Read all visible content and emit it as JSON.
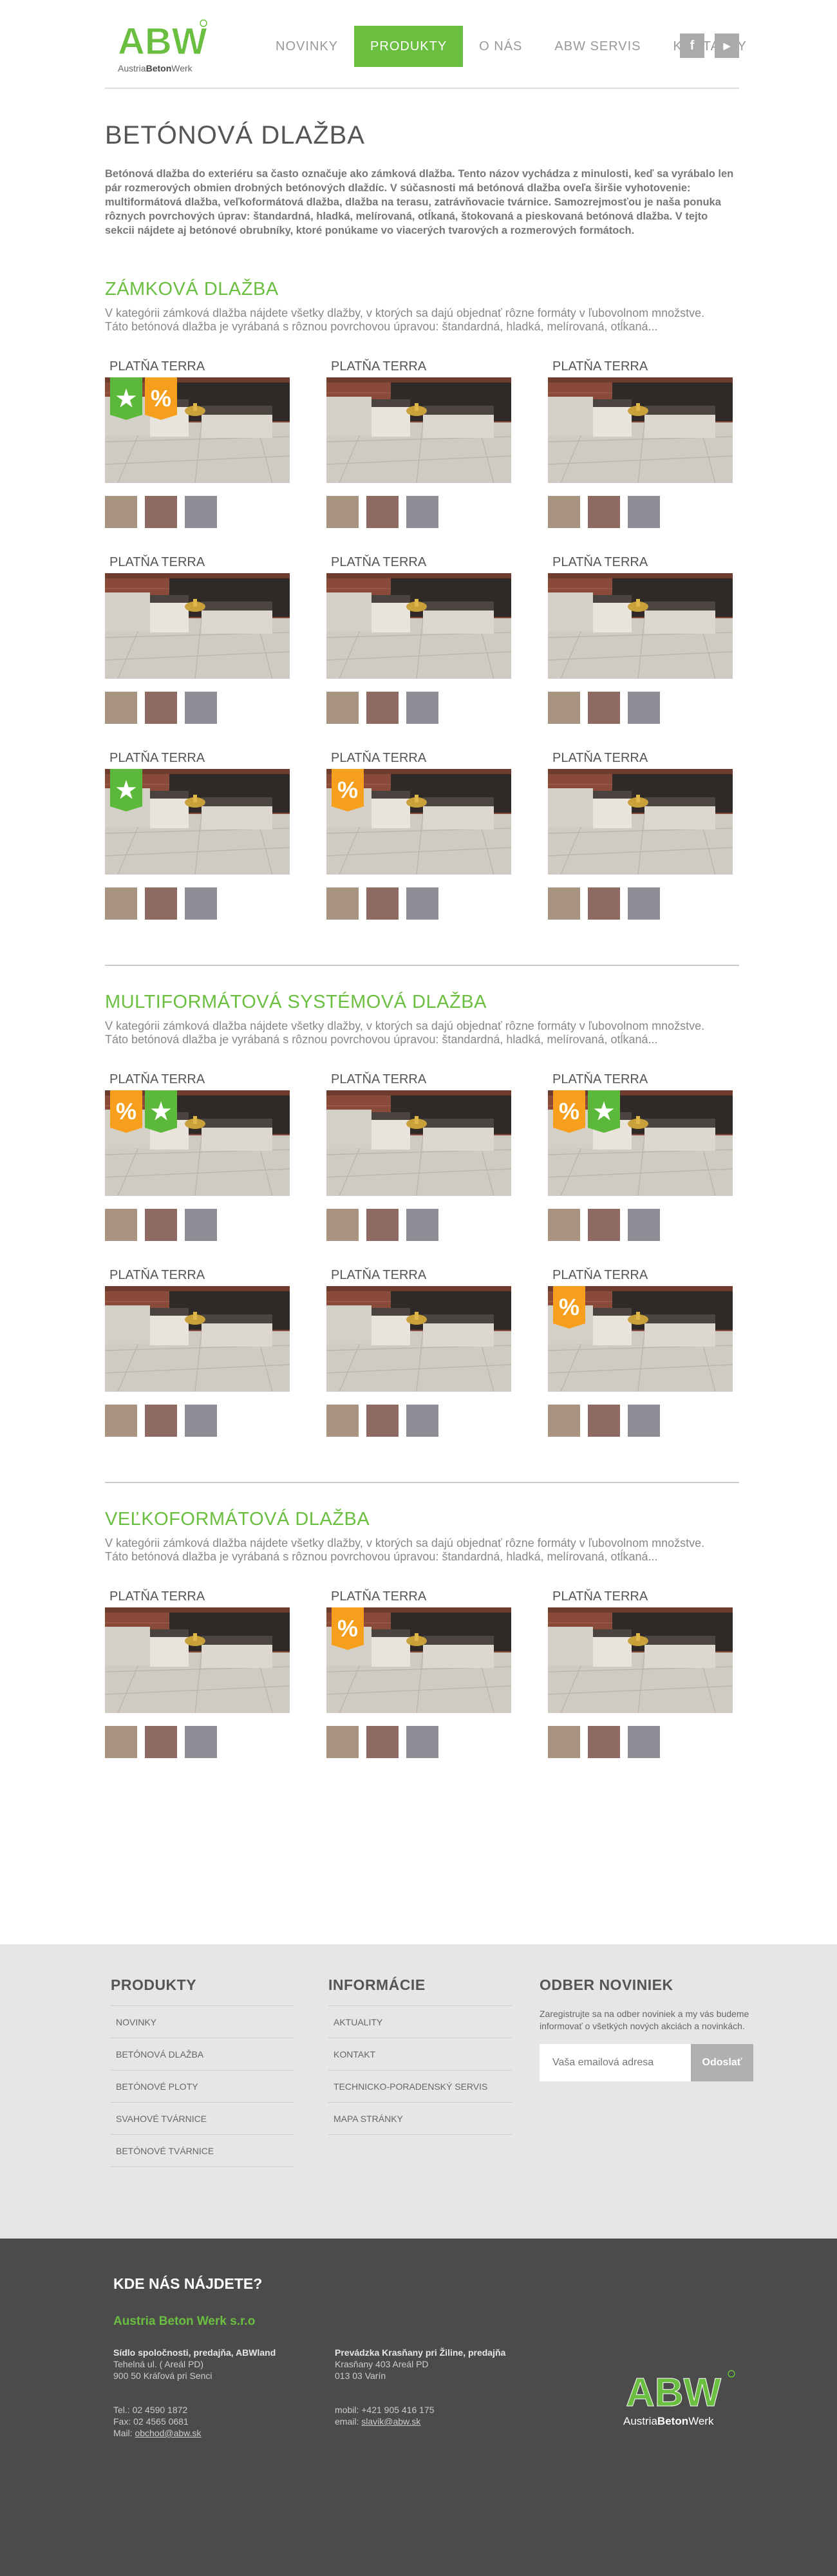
{
  "header": {
    "logo_text_light_1": "Austria",
    "logo_text_bold": "Beton",
    "logo_text_light_2": "Werk",
    "nav": [
      "NOVINKY",
      "PRODUKTY",
      "O NÁS",
      "ABW SERVIS",
      "KONTAKTY"
    ],
    "active_nav": "PRODUKTY",
    "social": [
      {
        "icon": "facebook-icon",
        "glyph": "f"
      },
      {
        "icon": "youtube-icon",
        "glyph": "▶"
      }
    ]
  },
  "page": {
    "title": "BETÓNOVÁ DLAŽBA",
    "intro": "Betónová dlažba do exteriéru sa často označuje ako zámková dlažba. Tento názov vychádza z minulosti, keď sa vyrábalo len pár rozmerových obmien drobných betónových dlaždíc. V súčasnosti má betónová dlažba oveľa širšie vyhotovenie: multiformátová dlažba, veľkoformátová dlažba, dlažba na terasu, zatrávňovacie tvárnice. Samozrejmosťou je naša ponuka rôznych povrchových úprav: štandardná, hladká, melírovaná, otĺkaná, štokovaná a pieskovaná betónová dlažba. V tejto sekcii nájdete aj betónové obrubníky, ktoré ponúkame vo viacerých tvarových a rozmerových formátoch."
  },
  "sections": [
    {
      "title": "ZÁMKOVÁ DLAŽBA",
      "description": "V kategórii zámková dlažba nájdete všetky dlažby, v ktorých sa dajú objednať rôzne formáty v ľubovolnom množstve.  Táto betónová dlažba je vyrábaná s rôznou povrchovou úpravou: štandardná, hladká, melírovaná, otĺkaná...",
      "products": [
        {
          "name": "PLATŇA TERRA",
          "badges": [
            "star",
            "percent"
          ]
        },
        {
          "name": "PLATŇA TERRA",
          "badges": []
        },
        {
          "name": "PLATŇA TERRA",
          "badges": []
        },
        {
          "name": "PLATŇA TERRA",
          "badges": []
        },
        {
          "name": "PLATŇA TERRA",
          "badges": []
        },
        {
          "name": "PLATŇA TERRA",
          "badges": []
        },
        {
          "name": "PLATŇA TERRA",
          "badges": [
            "star"
          ]
        },
        {
          "name": "PLATŇA TERRA",
          "badges": [
            "percent"
          ]
        },
        {
          "name": "PLATŇA TERRA",
          "badges": []
        }
      ]
    },
    {
      "title": "MULTIFORMÁTOVÁ SYSTÉMOVÁ DLAŽBA",
      "description": "V kategórii zámková dlažba nájdete všetky dlažby, v ktorých sa dajú objednať rôzne formáty v ľubovolnom množstve.  Táto betónová dlažba je vyrábaná s rôznou povrchovou úpravou: štandardná, hladká, melírovaná, otĺkaná...",
      "products": [
        {
          "name": "PLATŇA TERRA",
          "badges": [
            "percent",
            "star"
          ]
        },
        {
          "name": "PLATŇA TERRA",
          "badges": []
        },
        {
          "name": "PLATŇA TERRA",
          "badges": [
            "percent",
            "star"
          ]
        },
        {
          "name": "PLATŇA TERRA",
          "badges": []
        },
        {
          "name": "PLATŇA TERRA",
          "badges": []
        },
        {
          "name": "PLATŇA TERRA",
          "badges": [
            "percent"
          ]
        }
      ]
    },
    {
      "title": "VEĽKOFORMÁTOVÁ DLAŽBA",
      "description": "V kategórii zámková dlažba nájdete všetky dlažby, v ktorých sa dajú objednať rôzne formáty v ľubovolnom množstve.  Táto betónová dlažba je vyrábaná s rôznou povrchovou úpravou: štandardná, hladká, melírovaná, otĺkaná...",
      "products": [
        {
          "name": "PLATŇA TERRA",
          "badges": []
        },
        {
          "name": "PLATŇA TERRA",
          "badges": [
            "percent"
          ]
        },
        {
          "name": "PLATŇA TERRA",
          "badges": []
        }
      ]
    }
  ],
  "badge_glyphs": {
    "star": "★",
    "percent": "%"
  },
  "colors": {
    "accent": "#6bbf40",
    "badge_star": "#5cb83a",
    "badge_percent": "#f59f1c"
  },
  "footer": {
    "products_title": "PRODUKTY",
    "products_links": [
      "NOVINKY",
      "BETÓNOVÁ DLAŽBA",
      "BETÓNOVÉ PLOTY",
      "SVAHOVÉ TVÁRNICE",
      "BETÓNOVÉ TVÁRNICE"
    ],
    "info_title": "INFORMÁCIE",
    "info_links": [
      "AKTUALITY",
      "KONTAKT",
      "TECHNICKO-PORADENSKÝ SERVIS",
      "MAPA STRÁNKY"
    ],
    "newsletter_title": "ODBER NOVINIEK",
    "newsletter_text": "Zaregistrujte sa na odber noviniek a my vás budeme informovať o všetkých nových akciách a novinkách.",
    "newsletter_placeholder": "Vaša emailová adresa",
    "newsletter_button": "Odoslať"
  },
  "contact": {
    "title": "KDE NÁS NÁJDETE?",
    "company": "Austria Beton Werk s.r.o",
    "seat": {
      "heading": "Sídlo spoločnosti, predajňa, ABWland",
      "line1": "Tehelná ul. ( Areál PD)",
      "line2": "900 50 Kráľová pri Senci",
      "tel": "Tel.: 02 4590 1872",
      "fax": "Fax: 02 4565 0681",
      "mail_label": "Mail: ",
      "mail": "obchod@abw.sk"
    },
    "branch": {
      "heading": "Prevádzka Krasňany pri Žiline, predajňa",
      "line1": "Krasňany 403 Areál PD",
      "line2": "013 03 Varín",
      "mobile": "mobil: +421 905 416 175",
      "email_label": "email: ",
      "email": "slavik@abw.sk"
    }
  }
}
